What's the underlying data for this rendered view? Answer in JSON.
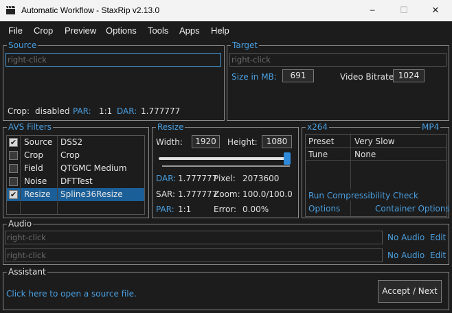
{
  "window": {
    "title": "Automatic Workflow - StaxRip v2.13.0",
    "minimize_glyph": "─",
    "maximize_glyph": "☐",
    "close_glyph": "✕"
  },
  "menu": [
    "File",
    "Crop",
    "Preview",
    "Options",
    "Tools",
    "Apps",
    "Help"
  ],
  "source": {
    "label": "Source",
    "input_placeholder": "right-click",
    "crop_label": "Crop:",
    "crop_value": "disabled",
    "par_label": "PAR:",
    "par_value": "1:1",
    "dar_label": "DAR:",
    "dar_value": "1.777777"
  },
  "target": {
    "label": "Target",
    "input_placeholder": "right-click",
    "size_label": "Size in MB:",
    "size_value": "691",
    "bitrate_label": "Video Bitrate:",
    "bitrate_value": "1024"
  },
  "avs_filters": {
    "label": "AVS Filters",
    "rows": [
      {
        "checked": true,
        "name": "Source",
        "value": "DSS2"
      },
      {
        "checked": false,
        "name": "Crop",
        "value": "Crop"
      },
      {
        "checked": false,
        "name": "Field",
        "value": "QTGMC Medium"
      },
      {
        "checked": false,
        "name": "Noise",
        "value": "DFTTest"
      },
      {
        "checked": true,
        "name": "Resize",
        "value": "Spline36Resize",
        "selected": true
      }
    ]
  },
  "resize": {
    "label": "Resize",
    "width_label": "Width:",
    "width_value": "1920",
    "height_label": "Height:",
    "height_value": "1080",
    "slider_level": 1.0,
    "dar_label": "DAR:",
    "dar_value": "1.777777",
    "pixel_label": "Pixel:",
    "pixel_value": "2073600",
    "sar_label": "SAR:",
    "sar_value": "1.777777",
    "zoom_label": "Zoom:",
    "zoom_value": "100.0/100.0",
    "par_label": "PAR:",
    "par_value": "1:1",
    "error_label": "Error:",
    "error_value": "0.00%"
  },
  "encoder": {
    "label": "x264",
    "container_label": "MP4",
    "rows": [
      {
        "name": "Preset",
        "value": "Very Slow"
      },
      {
        "name": "Tune",
        "value": "None"
      }
    ],
    "compressibility_link": "Run Compressibility Check",
    "options_link": "Options",
    "container_options_link": "Container Options"
  },
  "audio": {
    "label": "Audio",
    "tracks": [
      {
        "placeholder": "right-click",
        "codec": "No Audio",
        "edit": "Edit"
      },
      {
        "placeholder": "right-click",
        "codec": "No Audio",
        "edit": "Edit"
      }
    ]
  },
  "assistant": {
    "label": "Assistant",
    "message": "Click here to open a source file.",
    "next_button": "Accept / Next"
  },
  "colors": {
    "accent": "#4a9fe0",
    "background": "#1c1c1c",
    "selection": "#1b5f98"
  }
}
